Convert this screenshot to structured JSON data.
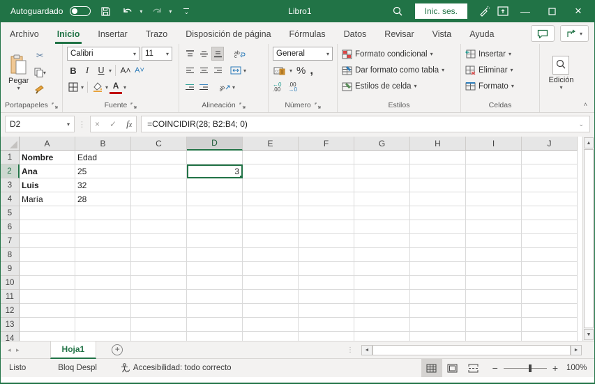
{
  "titlebar": {
    "autosave_label": "Autoguardado",
    "workbook_title": "Libro1",
    "signin_label": "Inic. ses."
  },
  "tabs": [
    {
      "label": "Archivo",
      "active": false
    },
    {
      "label": "Inicio",
      "active": true
    },
    {
      "label": "Insertar",
      "active": false
    },
    {
      "label": "Trazo",
      "active": false
    },
    {
      "label": "Disposición de página",
      "active": false
    },
    {
      "label": "Fórmulas",
      "active": false
    },
    {
      "label": "Datos",
      "active": false
    },
    {
      "label": "Revisar",
      "active": false
    },
    {
      "label": "Vista",
      "active": false
    },
    {
      "label": "Ayuda",
      "active": false
    }
  ],
  "ribbon": {
    "clipboard": {
      "label": "Portapapeles",
      "paste_label": "Pegar"
    },
    "font": {
      "label": "Fuente",
      "font_name": "Calibri",
      "font_size": "11",
      "bold": "B",
      "italic": "I",
      "underline": "U",
      "grow": "A˄",
      "shrink": "A˅",
      "color": "A"
    },
    "alignment": {
      "label": "Alineación",
      "wrap": "ab",
      "orient": "ab"
    },
    "number": {
      "label": "Número",
      "format": "General",
      "percent": "%",
      "comma": ",",
      "dec_inc_top": "←0",
      "dec_inc_bot": ".00",
      "dec_dec_top": ".00",
      "dec_dec_bot": "→0"
    },
    "styles": {
      "label": "Estilos",
      "items": [
        "Formato condicional",
        "Dar formato como tabla",
        "Estilos de celda"
      ]
    },
    "cells": {
      "label": "Celdas",
      "items": [
        "Insertar",
        "Eliminar",
        "Formato"
      ]
    },
    "editing": {
      "label": "Edición"
    }
  },
  "formula_bar": {
    "name_box": "D2",
    "formula": "=COINCIDIR(28; B2:B4; 0)"
  },
  "grid": {
    "columns": [
      "A",
      "B",
      "C",
      "D",
      "E",
      "F",
      "G",
      "H",
      "I",
      "J"
    ],
    "row_count": 14,
    "selected_cell": "D2",
    "selected_column": "D",
    "selected_row": 2,
    "cells": [
      {
        "ref": "A1",
        "value": "Nombre",
        "bold": true
      },
      {
        "ref": "B1",
        "value": "Edad"
      },
      {
        "ref": "A2",
        "value": "Ana",
        "bold": true
      },
      {
        "ref": "B2",
        "value": "25"
      },
      {
        "ref": "A3",
        "value": "Luis",
        "bold": true
      },
      {
        "ref": "B3",
        "value": "32"
      },
      {
        "ref": "A4",
        "value": "María"
      },
      {
        "ref": "B4",
        "value": "28"
      },
      {
        "ref": "D2",
        "value": "3",
        "align": "right"
      }
    ]
  },
  "sheet_bar": {
    "active_tab": "Hoja1"
  },
  "status_bar": {
    "mode": "Listo",
    "scroll_lock": "Bloq Despl",
    "accessibility": "Accesibilidad: todo correcto",
    "zoom_level": "100%"
  },
  "colors": {
    "accent_green": "#217346",
    "selection_green": "#217346",
    "font_color_red": "#c00000"
  }
}
